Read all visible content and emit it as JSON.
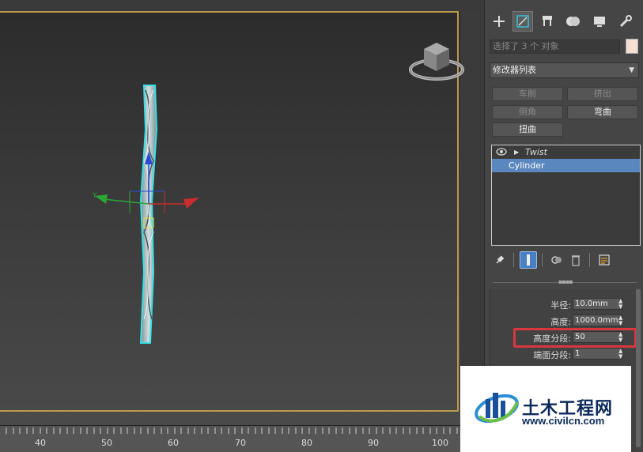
{
  "timeline": {
    "ticks": [
      "40",
      "50",
      "60",
      "70",
      "80",
      "90",
      "100"
    ]
  },
  "panel": {
    "tabs": [
      "create-icon",
      "modify-icon",
      "hierarchy-icon",
      "motion-icon",
      "display-icon",
      "utilities-icon"
    ],
    "selection_text": "选择了 3 个 对象",
    "swatch_color": "#f6dfd2",
    "modifier_list": "修改器列表",
    "buttons": {
      "lathe": "车削",
      "extrude": "挤出",
      "chamfer": "倒角",
      "bend": "弯曲",
      "twist": "扭曲"
    },
    "stack": {
      "twist": "Twist",
      "cylinder": "Cylinder"
    },
    "params": {
      "radius_label": "半径:",
      "radius_value": "10.0mm",
      "height_label": "高度:",
      "height_value": "1000.0mm",
      "height_segments_label": "高度分段:",
      "height_segments_value": "50",
      "cap_segments_label": "端面分段:",
      "cap_segments_value": "1"
    }
  },
  "viewport": {
    "axis_x": "X",
    "axis_y": "Y"
  },
  "watermark": {
    "title": "土木工程网",
    "url": "www.civilcn.com"
  },
  "colors": {
    "viewport_border": "#b89a4a",
    "selection_blue": "#5b87bf",
    "highlight_red": "#d9373f"
  }
}
